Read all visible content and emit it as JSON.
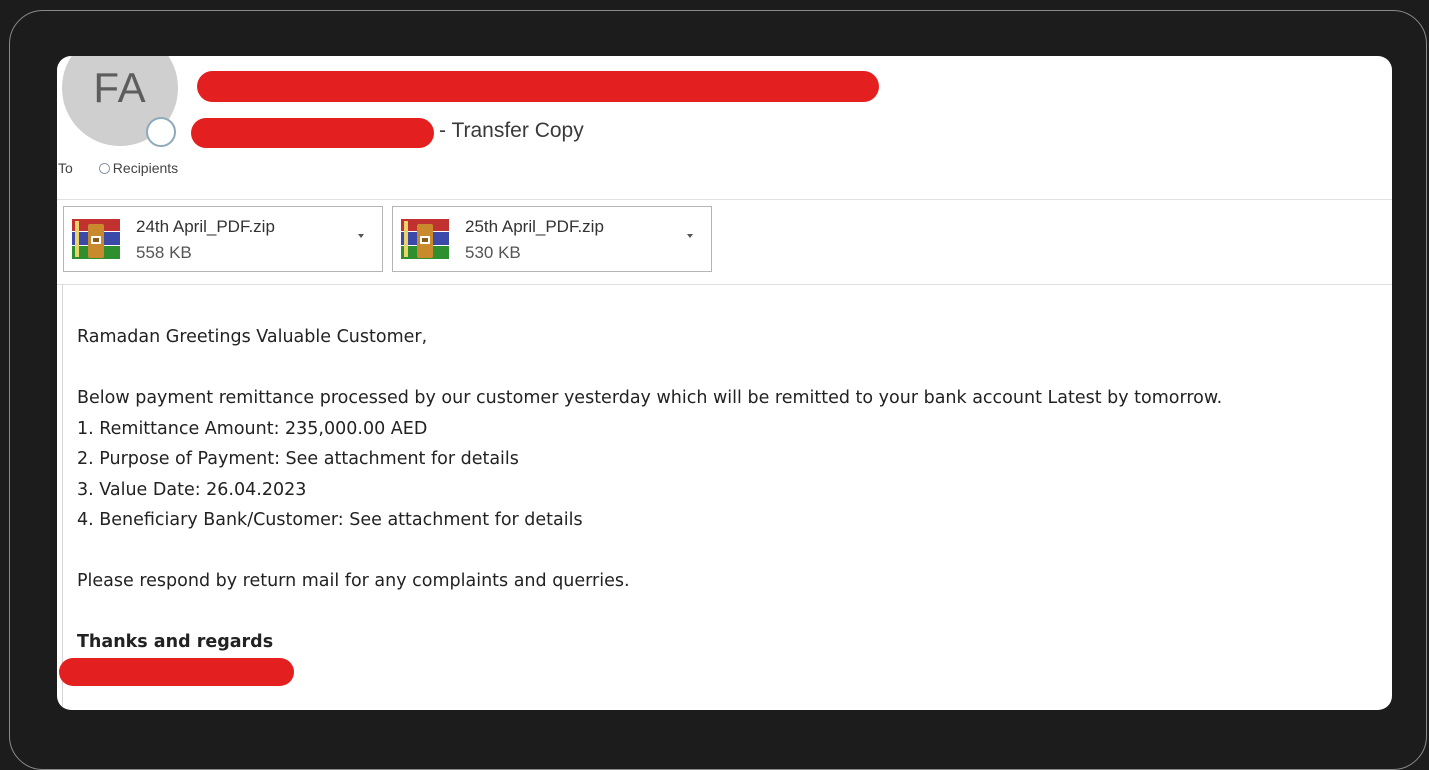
{
  "header": {
    "avatar_initials": "FA",
    "subject_suffix": "- Transfer Copy",
    "to_label": "To",
    "recipients_label": "Recipients"
  },
  "attachments": [
    {
      "name": "24th April_PDF.zip",
      "size": "558 KB",
      "icon": "winrar-archive-icon"
    },
    {
      "name": "25th April_PDF.zip",
      "size": "530 KB",
      "icon": "winrar-archive-icon"
    }
  ],
  "body": {
    "greeting": "Ramadan Greetings Valuable Customer,",
    "intro": "Below payment remittance processed by our customer yesterday which will be remitted to your bank account Latest by tomorrow.",
    "items": [
      "1. Remittance Amount: 235,000.00 AED",
      "2. Purpose of Payment: See attachment for details",
      "3. Value Date: 26.04.2023",
      "4. Beneficiary Bank/Customer: See attachment for details"
    ],
    "closing": "Please respond by return mail for any complaints and querries.",
    "signoff": "Thanks and regards"
  },
  "colors": {
    "redaction": "#e41f1f",
    "background": "#1c1c1c",
    "card": "#ffffff",
    "avatar": "#cfcfcf"
  }
}
